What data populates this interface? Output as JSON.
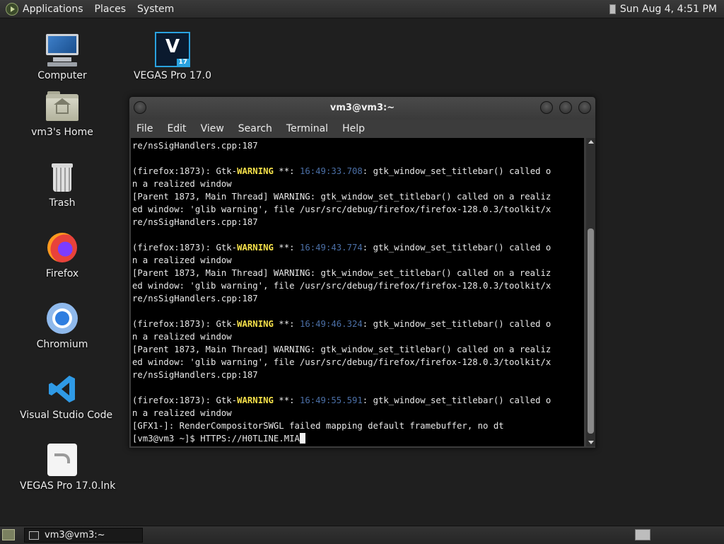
{
  "top_panel": {
    "menus": [
      "Applications",
      "Places",
      "System"
    ],
    "clock": "Sun Aug  4,  4:51 PM"
  },
  "desktop_icons": [
    {
      "label": "Computer",
      "icon": "computer-icon"
    },
    {
      "label": "VEGAS Pro 17.0",
      "icon": "vegas-pro-icon"
    },
    {
      "label": "vm3's Home",
      "icon": "home-folder-icon"
    },
    {
      "label": "Trash",
      "icon": "trash-icon"
    },
    {
      "label": "Firefox",
      "icon": "firefox-icon"
    },
    {
      "label": "Chromium",
      "icon": "chromium-icon"
    },
    {
      "label": "Visual Studio Code",
      "icon": "vscode-icon"
    },
    {
      "label": "VEGAS Pro 17.0.lnk",
      "icon": "shortcut-icon"
    }
  ],
  "vegas_icon_glyph": "V",
  "vegas_icon_badge": "17",
  "terminal": {
    "title": "vm3@vm3:~",
    "menus": [
      "File",
      "Edit",
      "View",
      "Search",
      "Terminal",
      "Help"
    ],
    "lines": [
      "re/nsSigHandlers.cpp:187",
      "",
      "(firefox:1873): Gtk-WARNING **: 16:49:33.708: gtk_window_set_titlebar() called o",
      "n a realized window",
      "[Parent 1873, Main Thread] WARNING: gtk_window_set_titlebar() called on a realiz",
      "ed window: 'glib warning', file /usr/src/debug/firefox/firefox-128.0.3/toolkit/x",
      "re/nsSigHandlers.cpp:187",
      "",
      "(firefox:1873): Gtk-WARNING **: 16:49:43.774: gtk_window_set_titlebar() called o",
      "n a realized window",
      "[Parent 1873, Main Thread] WARNING: gtk_window_set_titlebar() called on a realiz",
      "ed window: 'glib warning', file /usr/src/debug/firefox/firefox-128.0.3/toolkit/x",
      "re/nsSigHandlers.cpp:187",
      "",
      "(firefox:1873): Gtk-WARNING **: 16:49:46.324: gtk_window_set_titlebar() called o",
      "n a realized window",
      "[Parent 1873, Main Thread] WARNING: gtk_window_set_titlebar() called on a realiz",
      "ed window: 'glib warning', file /usr/src/debug/firefox/firefox-128.0.3/toolkit/x",
      "re/nsSigHandlers.cpp:187",
      "",
      "(firefox:1873): Gtk-WARNING **: 16:49:55.591: gtk_window_set_titlebar() called o",
      "n a realized window",
      "[GFX1-]: RenderCompositorSWGL failed mapping default framebuffer, no dt"
    ],
    "prompt": "[vm3@vm3 ~]$ ",
    "input": "HTTPS://H0TLINE.MIA"
  },
  "taskbar": {
    "window_button": "vm3@vm3:~"
  },
  "colors": {
    "warning": "#f5e04a",
    "timestamp": "#4b6fa6"
  }
}
